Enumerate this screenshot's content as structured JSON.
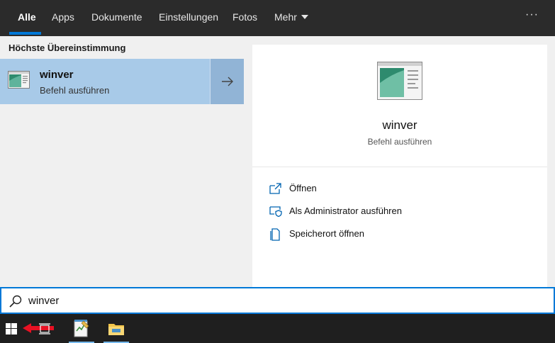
{
  "tabs": [
    {
      "label": "Alle",
      "active": true
    },
    {
      "label": "Apps"
    },
    {
      "label": "Dokumente"
    },
    {
      "label": "Einstellungen"
    },
    {
      "label": "Fotos"
    },
    {
      "label": "Mehr"
    }
  ],
  "more_options_icon": "ellipsis-icon",
  "results": {
    "section_title": "Höchste Übereinstimmung",
    "best_match": {
      "name": "winver",
      "subtitle": "Befehl ausführen",
      "icon": "winver-app-icon"
    }
  },
  "details": {
    "name": "winver",
    "subtitle": "Befehl ausführen",
    "actions": [
      {
        "label": "Öffnen",
        "icon": "open-icon"
      },
      {
        "label": "Als Administrator ausführen",
        "icon": "run-as-admin-icon"
      },
      {
        "label": "Speicherort öffnen",
        "icon": "file-location-icon"
      }
    ]
  },
  "search": {
    "value": "winver",
    "icon": "search-icon"
  },
  "taskbar": {
    "items": [
      "windows-start-icon",
      "task-view-icon",
      "notepad-app-icon",
      "file-explorer-icon"
    ]
  },
  "colors": {
    "accent": "#0078d7",
    "selection": "#a8cae8",
    "topbar": "#2b2b2b",
    "taskbar": "#1f1f1f",
    "annotation_arrow": "#e81123"
  }
}
